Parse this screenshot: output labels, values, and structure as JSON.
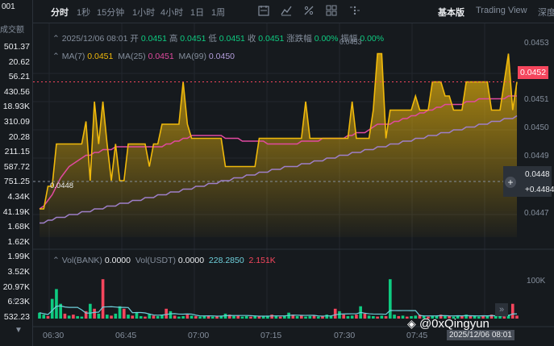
{
  "left_panel": {
    "header": "001",
    "column_label": "成交额",
    "values": [
      "501.37",
      "20.62",
      "56.21",
      "430.56",
      "18.93K",
      "310.09",
      "20.28",
      "211.15",
      "587.72",
      "751.25",
      "4.34K",
      "41.19K",
      "1.68K",
      "1.62K",
      "1.99K",
      "3.52K",
      "20.97K",
      "6.23K",
      "532.23"
    ]
  },
  "toolbar": {
    "intervals": [
      "分时",
      "1秒",
      "15分钟",
      "1小时",
      "4小时",
      "1日",
      "1周"
    ],
    "active_interval": "分时",
    "views": [
      "基本版",
      "Trading View",
      "深度"
    ],
    "active_view": "基本版"
  },
  "info_bar": {
    "datetime": "2025/12/06 08:01",
    "open_label": "开",
    "open": "0.0451",
    "high_label": "高",
    "high": "0.0451",
    "low_label": "低",
    "low": "0.0451",
    "close_label": "收",
    "close": "0.0451",
    "change_label": "涨跌幅",
    "change": "0.00%",
    "amp_label": "振幅",
    "amp": "0.00%"
  },
  "ma_bar": {
    "ma7_label": "MA(7)",
    "ma7": "0.0451",
    "ma25_label": "MA(25)",
    "ma25": "0.0451",
    "ma99_label": "MA(99)",
    "ma99": "0.0450"
  },
  "vol_bar": {
    "vol_bank_label": "Vol(BANK)",
    "vol_bank": "0.0000",
    "vol_usdt_label": "Vol(USDT)",
    "vol_usdt": "0.0000",
    "v1": "228.2850",
    "v2": "2.151K"
  },
  "price_axis": [
    "0.0453",
    "0.0452",
    "0.0451",
    "0.0450",
    "0.0449",
    "0.0448",
    "0.0447"
  ],
  "current_price": "0.0452",
  "crosshair_price": "0.0448",
  "crosshair_plus": "+0.4484",
  "line_label_low": "0.0448",
  "line_label_high": "0.0453",
  "vol_axis": "100K",
  "time_axis": [
    "06:30",
    "06:45",
    "07:00",
    "07:15",
    "07:30",
    "07:45"
  ],
  "time_tag": "2025/12/06 08:01",
  "watermark": "@0xQingyun",
  "colors": {
    "line": "#f0b90b",
    "ma25": "#e14aa0",
    "ma99": "#9e7fc9",
    "up": "#0ecb81",
    "down": "#f6465d",
    "bg": "#161a1e"
  },
  "chart_data": {
    "type": "line",
    "ylim": [
      0.04465,
      0.04535
    ],
    "price": [
      0.04475,
      0.04475,
      0.04483,
      0.04483,
      0.04498,
      0.04498,
      0.04498,
      0.04498,
      0.04498,
      0.04498,
      0.04498,
      0.04506,
      0.04485,
      0.04513,
      0.04498,
      0.04513,
      0.04498,
      0.04485,
      0.04498,
      0.04485,
      0.04485,
      0.04498,
      0.04498,
      0.04498,
      0.04498,
      0.04498,
      0.0449,
      0.04498,
      0.04498,
      0.04505,
      0.04505,
      0.04505,
      0.04505,
      0.04505,
      0.0452,
      0.04505,
      0.045,
      0.045,
      0.045,
      0.045,
      0.045,
      0.045,
      0.045,
      0.045,
      0.0449,
      0.0449,
      0.0449,
      0.0449,
      0.0449,
      0.0449,
      0.0449,
      0.0449,
      0.045,
      0.045,
      0.045,
      0.045,
      0.045,
      0.045,
      0.045,
      0.045,
      0.045,
      0.045,
      0.045,
      0.04513,
      0.045,
      0.045,
      0.045,
      0.045,
      0.045,
      0.045,
      0.045,
      0.045,
      0.045,
      0.045,
      0.04513,
      0.045,
      0.045,
      0.045,
      0.045,
      0.0451,
      0.0453,
      0.0453,
      0.045,
      0.0451,
      0.0451,
      0.0451,
      0.0451,
      0.0451,
      0.0451,
      0.04515,
      0.0451,
      0.0451,
      0.0451,
      0.0452,
      0.0452,
      0.0452,
      0.04515,
      0.04515,
      0.0451,
      0.0451,
      0.0451,
      0.0452,
      0.0452,
      0.0452,
      0.0452,
      0.0452,
      0.0452,
      0.0451,
      0.0451,
      0.0451,
      0.0452,
      0.0453,
      0.0451,
      0.0452
    ],
    "ma25": [
      0.04475,
      0.04476,
      0.04478,
      0.0448,
      0.04483,
      0.04486,
      0.04488,
      0.0449,
      0.04491,
      0.04492,
      0.04493,
      0.04494,
      0.04494,
      0.04495,
      0.04495,
      0.04496,
      0.04496,
      0.04496,
      0.04497,
      0.04497,
      0.04497,
      0.04497,
      0.04497,
      0.04497,
      0.04497,
      0.04497,
      0.04497,
      0.04497,
      0.04497,
      0.04497,
      0.04498,
      0.04498,
      0.04499,
      0.04499,
      0.045,
      0.045,
      0.04501,
      0.04501,
      0.04501,
      0.04501,
      0.04501,
      0.04501,
      0.04501,
      0.04501,
      0.045,
      0.045,
      0.045,
      0.045,
      0.04499,
      0.04499,
      0.04499,
      0.04499,
      0.04499,
      0.04499,
      0.04498,
      0.04498,
      0.04498,
      0.04498,
      0.04498,
      0.04498,
      0.04498,
      0.04498,
      0.04499,
      0.04499,
      0.04499,
      0.04499,
      0.04499,
      0.045,
      0.045,
      0.045,
      0.045,
      0.045,
      0.045,
      0.04501,
      0.04501,
      0.04502,
      0.04502,
      0.04502,
      0.04503,
      0.04504,
      0.04505,
      0.04505,
      0.04505,
      0.04505,
      0.04506,
      0.04506,
      0.04507,
      0.04507,
      0.04508,
      0.04508,
      0.04509,
      0.04509,
      0.0451,
      0.0451,
      0.04511,
      0.04511,
      0.04512,
      0.04512,
      0.04512,
      0.04512,
      0.04512,
      0.04513,
      0.04513,
      0.04513,
      0.04514,
      0.04514,
      0.04514,
      0.04514,
      0.04514,
      0.04514,
      0.04514,
      0.04515,
      0.04515,
      0.04515
    ],
    "ma99": [
      0.0447,
      0.0447,
      0.04471,
      0.04471,
      0.04472,
      0.04472,
      0.04472,
      0.04473,
      0.04473,
      0.04473,
      0.04474,
      0.04474,
      0.04474,
      0.04475,
      0.04475,
      0.04475,
      0.04476,
      0.04476,
      0.04476,
      0.04477,
      0.04477,
      0.04477,
      0.04478,
      0.04478,
      0.04478,
      0.04479,
      0.04479,
      0.04479,
      0.0448,
      0.0448,
      0.0448,
      0.04481,
      0.04481,
      0.04481,
      0.04482,
      0.04482,
      0.04482,
      0.04483,
      0.04483,
      0.04483,
      0.04484,
      0.04484,
      0.04484,
      0.04485,
      0.04485,
      0.04485,
      0.04486,
      0.04486,
      0.04486,
      0.04487,
      0.04487,
      0.04487,
      0.04488,
      0.04488,
      0.04488,
      0.04489,
      0.04489,
      0.04489,
      0.0449,
      0.0449,
      0.0449,
      0.0449,
      0.04491,
      0.04491,
      0.04491,
      0.04492,
      0.04492,
      0.04492,
      0.04493,
      0.04493,
      0.04493,
      0.04494,
      0.04494,
      0.04494,
      0.04495,
      0.04495,
      0.04495,
      0.04496,
      0.04496,
      0.04496,
      0.04497,
      0.04497,
      0.04497,
      0.04498,
      0.04498,
      0.04498,
      0.04499,
      0.04499,
      0.04499,
      0.045,
      0.045,
      0.045,
      0.04501,
      0.04501,
      0.04501,
      0.04502,
      0.04502,
      0.04502,
      0.04503,
      0.04503,
      0.04503,
      0.04504,
      0.04504,
      0.04504,
      0.04505,
      0.04505,
      0.04505,
      0.04506,
      0.04506,
      0.04506,
      0.04507,
      0.04507,
      0.04507,
      0.04508
    ],
    "volume": [
      12,
      8,
      5,
      40,
      60,
      30,
      10,
      6,
      8,
      5,
      4,
      15,
      30,
      20,
      10,
      80,
      8,
      6,
      10,
      25,
      20,
      8,
      6,
      12,
      5,
      4,
      10,
      6,
      5,
      8,
      20,
      15,
      6,
      4,
      5,
      8,
      6,
      5,
      4,
      6,
      5,
      4,
      5,
      6,
      10,
      8,
      5,
      6,
      4,
      5,
      4,
      6,
      5,
      4,
      6,
      8,
      5,
      4,
      6,
      12,
      8,
      5,
      6,
      4,
      5,
      6,
      4,
      5,
      8,
      6,
      20,
      15,
      8,
      5,
      6,
      8,
      25,
      10,
      6,
      5,
      4,
      6,
      5,
      80,
      8,
      5,
      6,
      4,
      5,
      6,
      8,
      5,
      4,
      6,
      5,
      8,
      6,
      5,
      4,
      6,
      5,
      8,
      6,
      5,
      4,
      6,
      5,
      8,
      6,
      5,
      4,
      8,
      30,
      6
    ],
    "volume_up": [
      true,
      true,
      false,
      true,
      true,
      true,
      false,
      true,
      false,
      true,
      true,
      false,
      true,
      false,
      true,
      false,
      true,
      false,
      true,
      true,
      false,
      true,
      false,
      true,
      true,
      false,
      true,
      false,
      true,
      true,
      false,
      true,
      false,
      true,
      true,
      false,
      true,
      false,
      true,
      true,
      false,
      true,
      false,
      true,
      true,
      false,
      true,
      false,
      true,
      true,
      false,
      true,
      false,
      true,
      true,
      false,
      true,
      false,
      true,
      true,
      false,
      true,
      false,
      true,
      true,
      false,
      true,
      false,
      true,
      true,
      false,
      true,
      false,
      true,
      true,
      false,
      true,
      false,
      true,
      true,
      false,
      true,
      false,
      true,
      true,
      false,
      true,
      false,
      true,
      true,
      false,
      true,
      false,
      true,
      true,
      false,
      true,
      false,
      true,
      true,
      false,
      true,
      false,
      true,
      true,
      false,
      true,
      false,
      true,
      true,
      false,
      true,
      false,
      false
    ]
  }
}
